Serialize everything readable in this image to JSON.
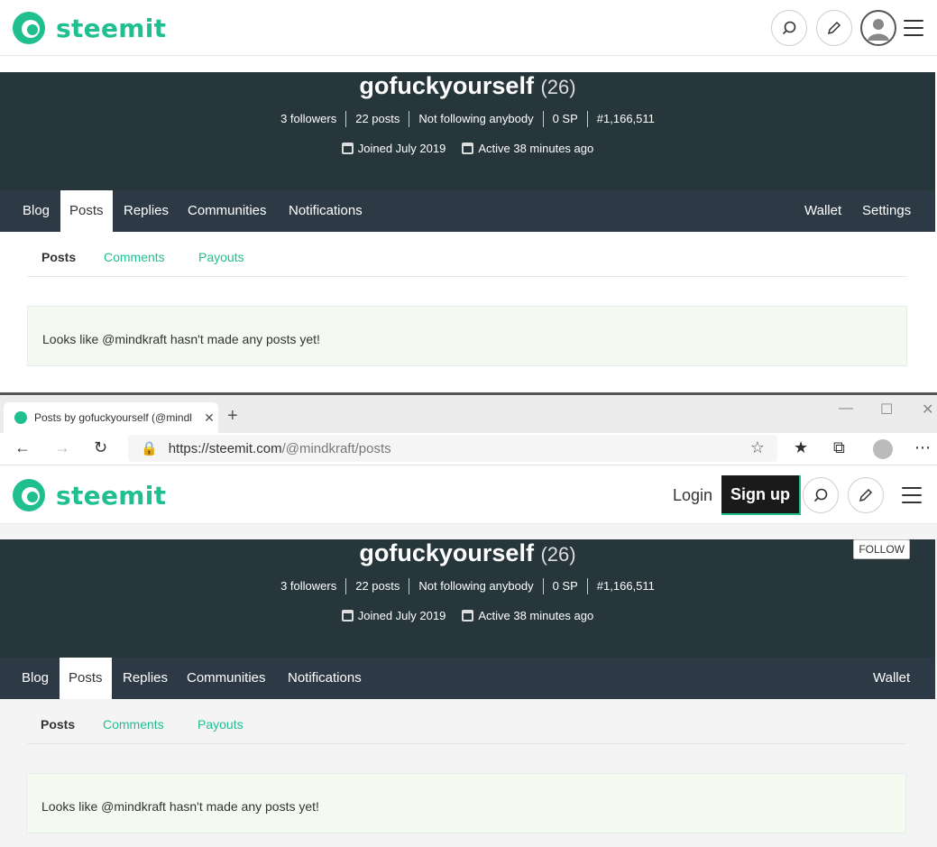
{
  "brand": {
    "name": "steemit",
    "color": "#1fbf8f"
  },
  "colors": {
    "hero_bg": "#26363b",
    "nav_bg": "#2d3a45",
    "notice_bg": "#f4faf0"
  },
  "header_top": {
    "icons": [
      "search-icon",
      "pencil-icon",
      "user-avatar-icon",
      "hamburger-icon"
    ]
  },
  "header_bottom": {
    "login_label": "Login",
    "signup_label": "Sign up",
    "icons": [
      "search-icon",
      "pencil-icon",
      "hamburger-icon"
    ]
  },
  "profile": {
    "name": "gofuckyourself",
    "reputation": "(26)",
    "stats": [
      "3 followers",
      "22 posts",
      "Not following anybody",
      "0 SP",
      "#1,166,511"
    ],
    "joined": "Joined July 2019",
    "active": "Active 38 minutes ago",
    "follow_label": "FOLLOW"
  },
  "nav_top": {
    "items": [
      "Blog",
      "Posts",
      "Replies",
      "Communities",
      "Notifications"
    ],
    "right_items": [
      "Wallet",
      "Settings"
    ],
    "active": "Posts"
  },
  "nav_bottom": {
    "items": [
      "Blog",
      "Posts",
      "Replies",
      "Communities",
      "Notifications"
    ],
    "right_items": [
      "Wallet"
    ],
    "active": "Posts"
  },
  "subtabs": [
    "Posts",
    "Comments",
    "Payouts"
  ],
  "notice": "Looks like @mindkraft hasn't made any posts yet!",
  "browser": {
    "tab_title": "Posts by gofuckyourself (@mindl",
    "tab_close": "✕",
    "new_tab": "+",
    "url_host": "https://steemit.com",
    "url_path": "/@mindkraft/posts",
    "window_controls": [
      "—",
      "☐",
      "✕"
    ]
  }
}
